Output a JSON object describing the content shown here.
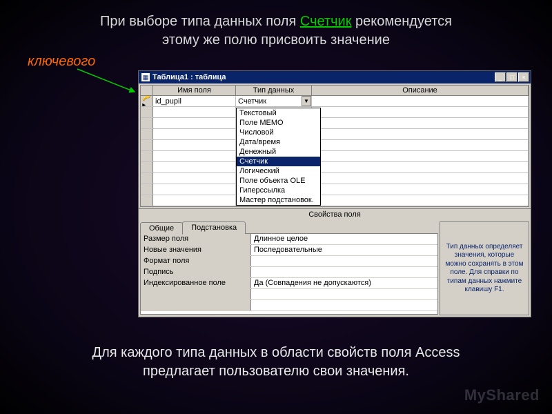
{
  "slide": {
    "top_line1_a": "При выборе типа данных поля ",
    "top_line1_highlight": "Счетчик",
    "top_line1_b": " рекомендуется",
    "top_line2": "этому же полю присвоить значение",
    "key_label": "ключевого",
    "bottom_line1": "Для каждого типа данных в области свойств поля Access",
    "bottom_line2": "предлагает пользователю свои значения.",
    "watermark": "MyShared"
  },
  "window": {
    "title": "Таблица1 : таблица",
    "columns": {
      "name": "Имя поля",
      "type": "Тип данных",
      "desc": "Описание"
    },
    "row0": {
      "field": "id_pupil",
      "typeval": "Счетчик"
    },
    "dropdown": {
      "items": [
        "Текстовый",
        "Поле МЕМО",
        "Числовой",
        "Дата/время",
        "Денежный",
        "Счетчик",
        "Логический",
        "Поле объекта OLE",
        "Гиперссылка",
        "Мастер подстановок."
      ],
      "selected_index": 5
    },
    "props_header": "Свойства поля",
    "tabs": {
      "general": "Общие",
      "lookup": "Подстановка"
    },
    "properties": [
      {
        "label": "Размер поля",
        "value": "Длинное целое"
      },
      {
        "label": "Новые значения",
        "value": "Последовательные"
      },
      {
        "label": "Формат поля",
        "value": ""
      },
      {
        "label": "Подпись",
        "value": ""
      },
      {
        "label": "Индексированное поле",
        "value": "Да (Совпадения не допускаются)"
      }
    ],
    "help_text": "Тип данных определяет значения, которые можно сохранять в этом поле. Для справки по типам данных нажмите клавишу F1."
  }
}
